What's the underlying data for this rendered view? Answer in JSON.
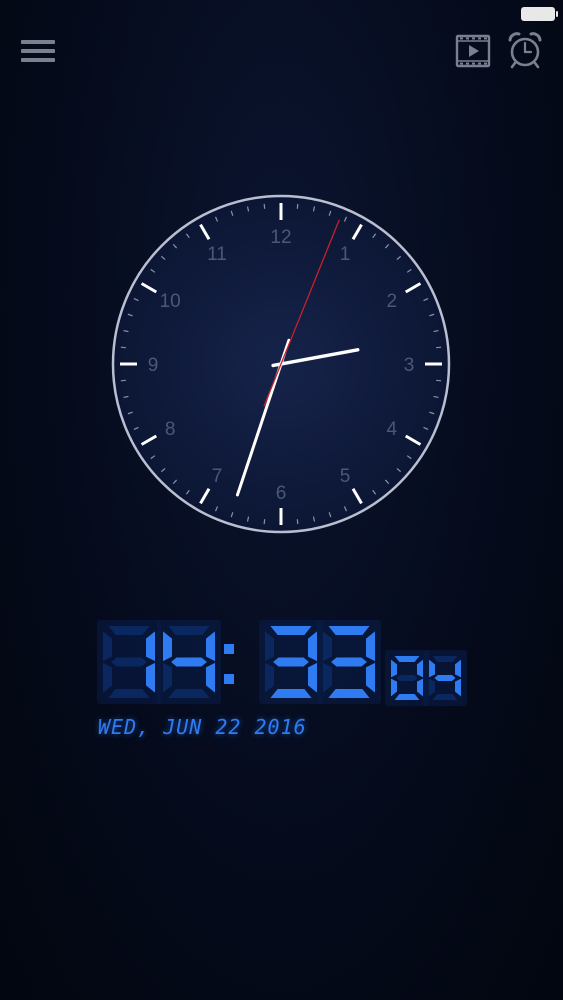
{
  "colors": {
    "digit_on": "#2f7cf2",
    "digit_off": "#0c2a66",
    "second_hand": "#c8202a",
    "hand": "#ffffff",
    "dial_numbers": "#4a5878",
    "toolbar_icon": "#7a8090"
  },
  "toolbar": {
    "menu_icon": "hamburger-icon",
    "video_icon": "video-film-icon",
    "alarm_icon": "alarm-clock-icon"
  },
  "analog_clock": {
    "numbers": [
      "12",
      "1",
      "2",
      "3",
      "4",
      "5",
      "6",
      "7",
      "8",
      "9",
      "10",
      "11"
    ],
    "hours": 14,
    "minutes": 33,
    "seconds": 4
  },
  "digital_clock": {
    "hours": "14",
    "minutes": "33",
    "seconds": "04",
    "separator": ":",
    "date": "WED, JUN 22 2016"
  }
}
